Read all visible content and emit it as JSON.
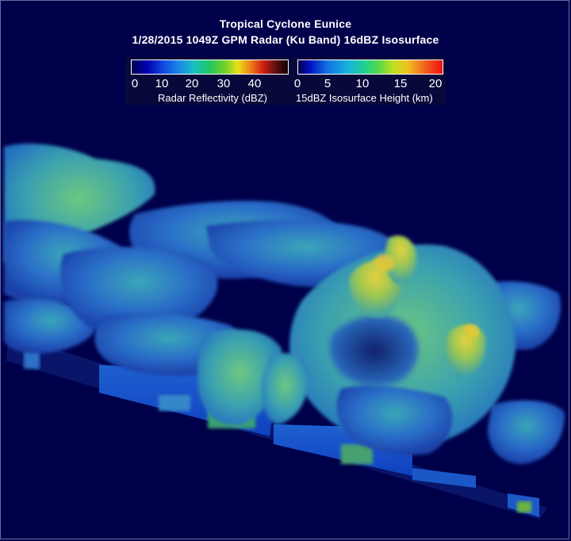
{
  "title": "Tropical Cyclone Eunice",
  "subtitle": "1/28/2015 1049Z GPM Radar (Ku Band) 16dBZ Isosurface",
  "legends": [
    {
      "label": "Radar Reflectivity (dBZ)",
      "ticks": [
        "0",
        "10",
        "20",
        "30",
        "40"
      ]
    },
    {
      "label": "15dBZ Isosurface Height (km)",
      "ticks": [
        "0",
        "5",
        "10",
        "15",
        "20"
      ]
    }
  ],
  "colors": {
    "background": "#00004a",
    "low": "#1048e0",
    "mid": "#20c860",
    "high": "#e8e018"
  }
}
